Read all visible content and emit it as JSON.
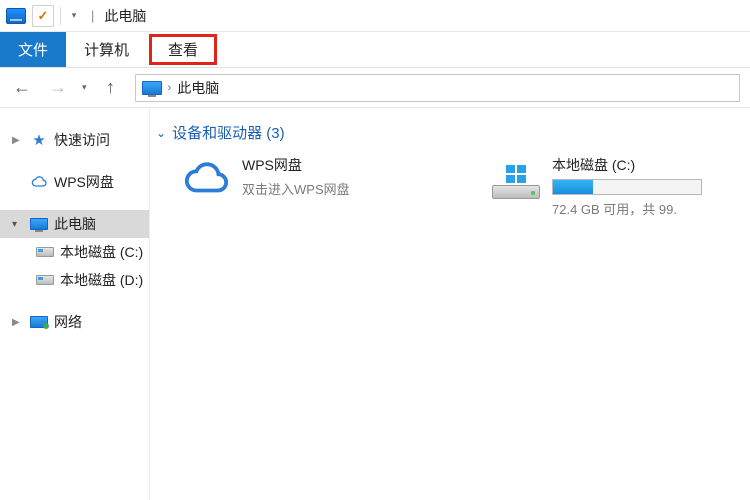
{
  "titlebar": {
    "window_title": "此电脑",
    "pipe": "|"
  },
  "tabs": {
    "file": "文件",
    "computer": "计算机",
    "view": "查看"
  },
  "nav": {
    "back": "←",
    "forward": "→",
    "up": "↑",
    "drop": "▾",
    "chevron": "›",
    "location": "此电脑"
  },
  "sidebar": {
    "quick_access": "快速访问",
    "wps": "WPS网盘",
    "this_pc": "此电脑",
    "drive_c": "本地磁盘 (C:)",
    "drive_d": "本地磁盘 (D:)",
    "network": "网络"
  },
  "content": {
    "group_label": "设备和驱动器 (3)",
    "wps_item": {
      "title": "WPS网盘",
      "subtitle": "双击进入WPS网盘"
    },
    "drive_c_item": {
      "title": "本地磁盘 (C:)",
      "usage_text": "72.4 GB 可用，共 99."
    }
  }
}
